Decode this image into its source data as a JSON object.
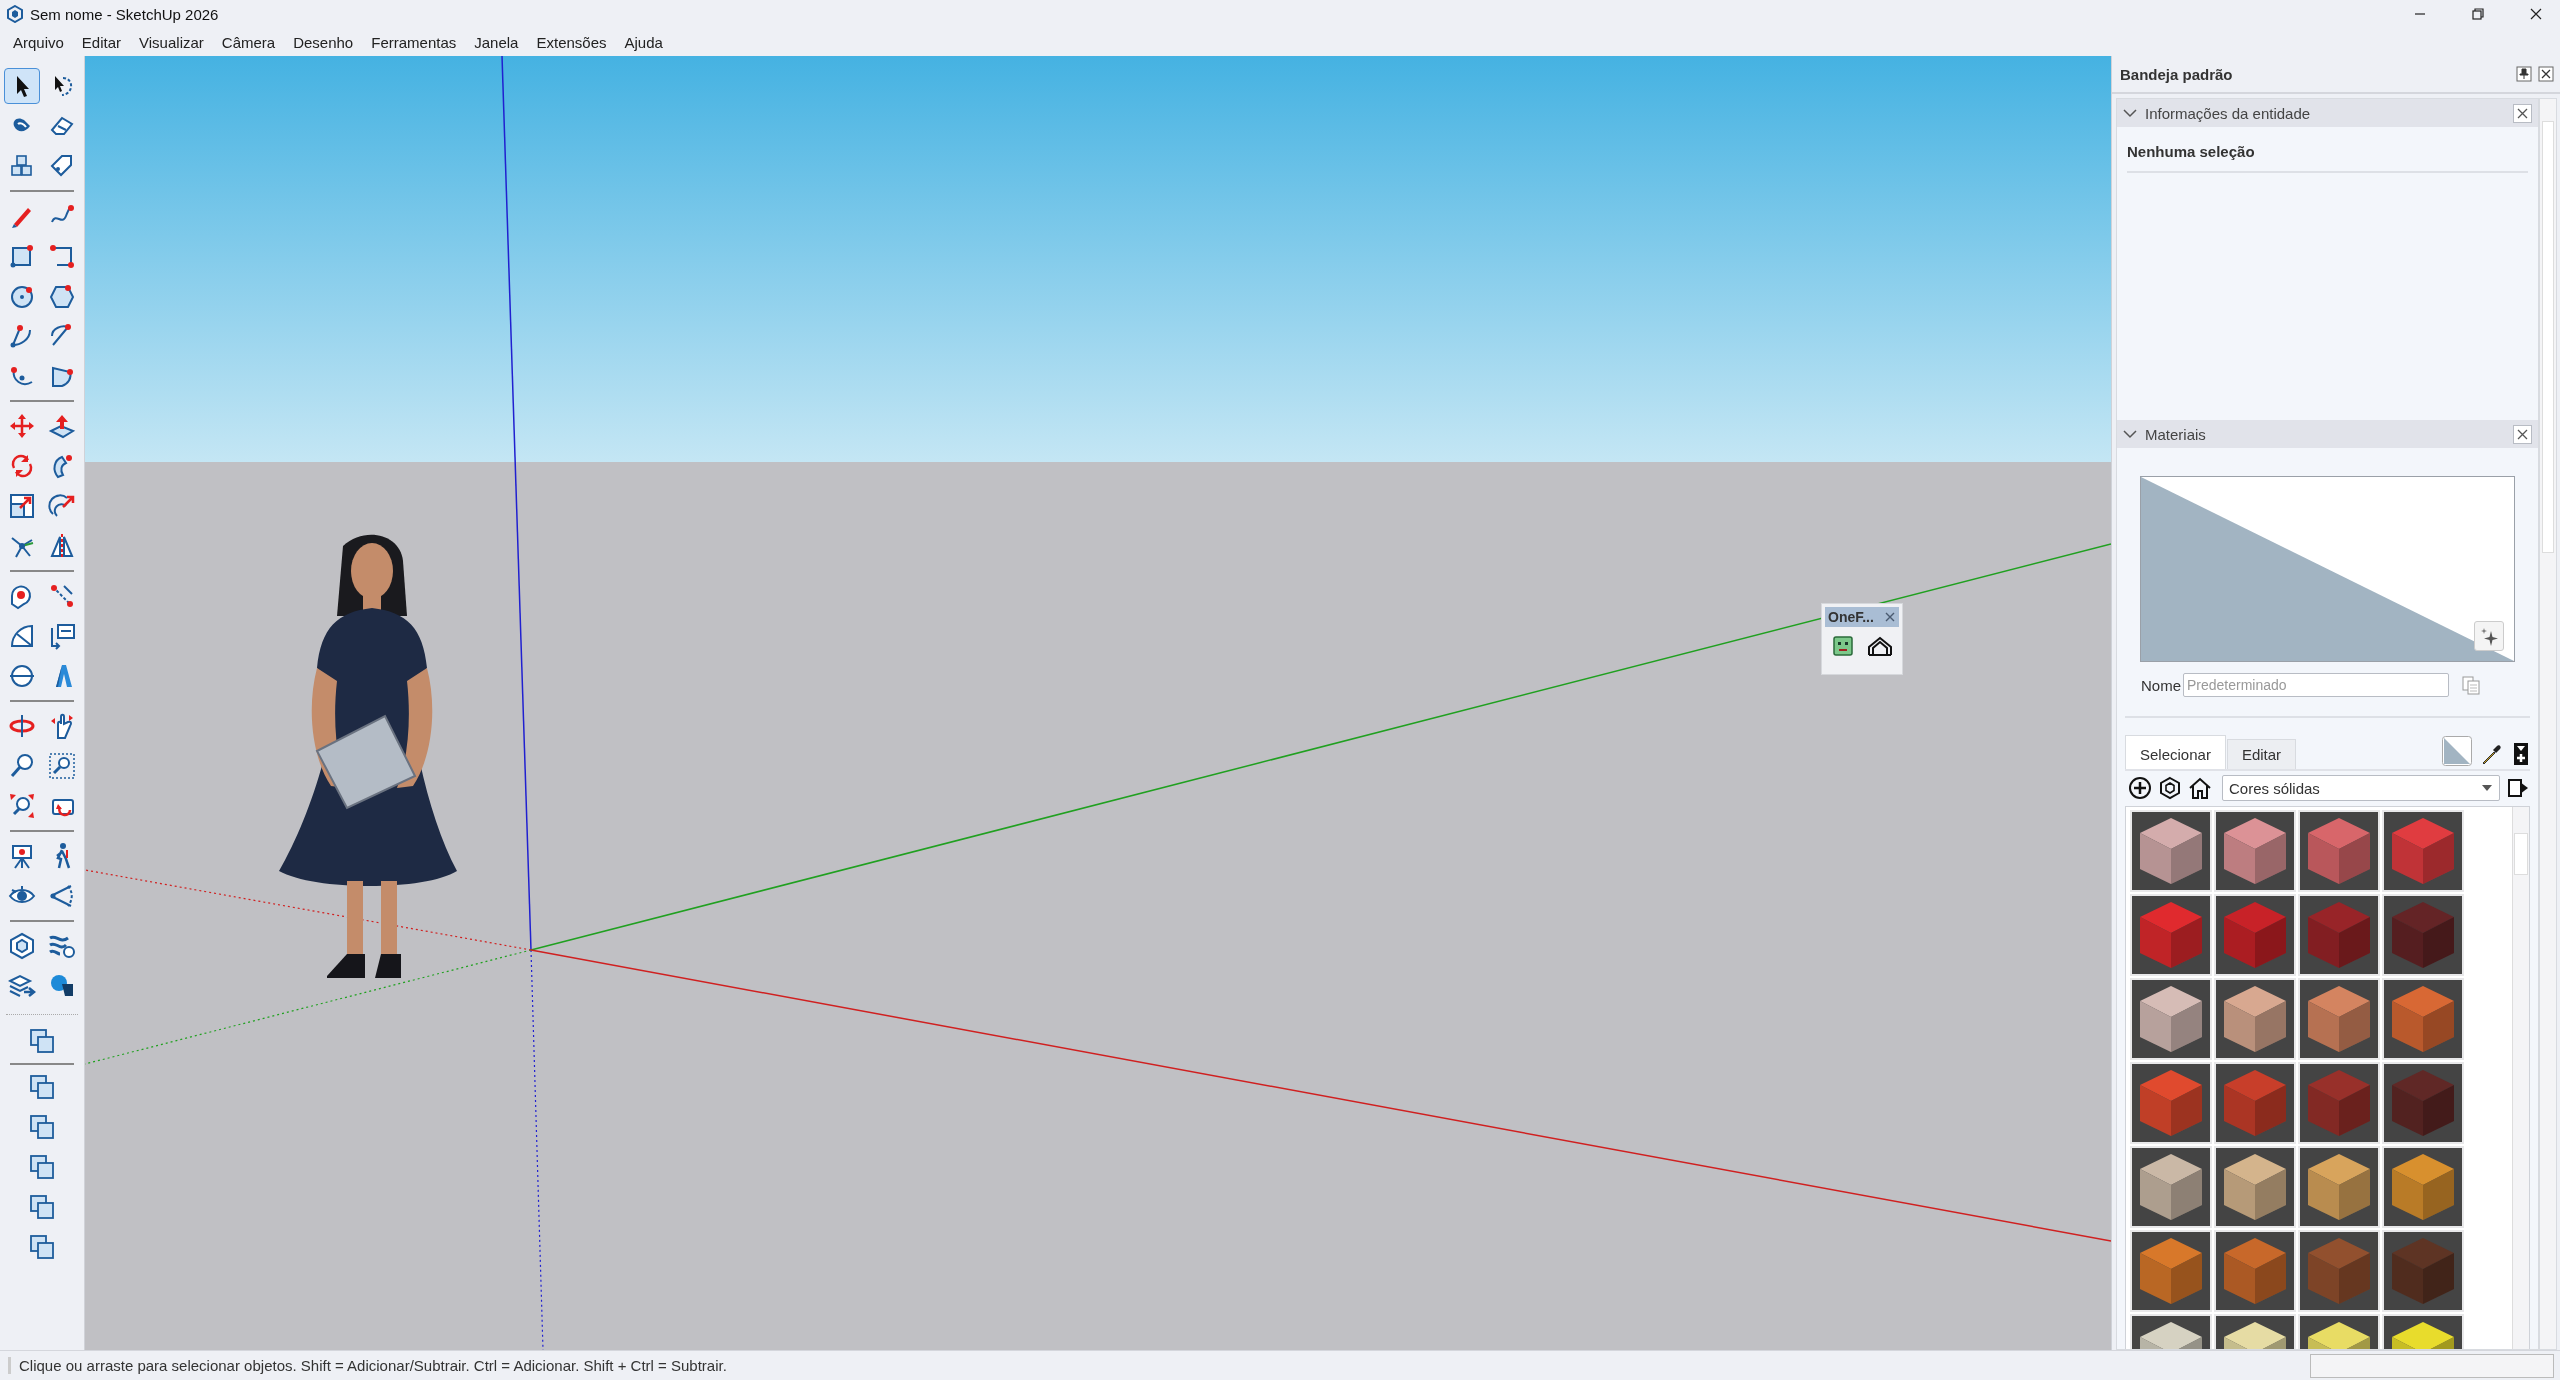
{
  "window": {
    "title": "Sem nome - SketchUp 2026"
  },
  "menu": [
    "Arquivo",
    "Editar",
    "Visualizar",
    "Câmera",
    "Desenho",
    "Ferramentas",
    "Janela",
    "Extensões",
    "Ajuda"
  ],
  "toolbar": {
    "groups": [
      {
        "tools": [
          {
            "selected": true
          },
          {
            "selected": false
          },
          {
            "selected": false
          },
          {
            "selected": false
          },
          {
            "selected": false
          },
          {
            "selected": false
          }
        ]
      },
      {
        "tools": [
          {
            "selected": false
          },
          {
            "selected": false
          },
          {
            "selected": false
          },
          {
            "selected": false
          },
          {
            "selected": false
          },
          {
            "selected": false
          },
          {
            "selected": false
          },
          {
            "selected": false
          },
          {
            "selected": false
          },
          {
            "selected": false
          }
        ]
      },
      {
        "tools": [
          {
            "selected": false
          },
          {
            "selected": false
          },
          {
            "selected": false
          },
          {
            "selected": false
          },
          {
            "selected": false
          },
          {
            "selected": false
          },
          {
            "selected": false
          },
          {
            "selected": false
          }
        ]
      },
      {
        "tools": [
          {
            "selected": false
          },
          {
            "selected": false
          },
          {
            "selected": false
          },
          {
            "selected": false
          },
          {
            "selected": false
          },
          {
            "selected": false
          }
        ]
      },
      {
        "tools": [
          {
            "selected": false
          },
          {
            "selected": false
          },
          {
            "selected": false
          },
          {
            "selected": false
          },
          {
            "selected": false
          },
          {
            "selected": false
          }
        ]
      },
      {
        "tools": [
          {
            "selected": false
          },
          {
            "selected": false
          },
          {
            "selected": false
          },
          {
            "selected": false
          }
        ]
      },
      {
        "tools": [
          {
            "selected": false
          },
          {
            "selected": false
          },
          {
            "selected": false
          },
          {
            "selected": false
          }
        ]
      }
    ]
  },
  "floating_toolbar": {
    "title": "OneF..."
  },
  "tray": {
    "title": "Bandeja padrão",
    "panels": [
      {
        "kind": "entity_info",
        "title": "Informações da entidade",
        "expanded": true,
        "heading": "Nenhuma seleção"
      },
      {
        "kind": "materials",
        "title": "Materiais",
        "expanded": true,
        "name_field": {
          "label": "Nome",
          "placeholder": "Predeterminado"
        },
        "tabs": [
          {
            "label": "Selecionar",
            "selected": true
          },
          {
            "label": "Editar",
            "selected": false
          }
        ],
        "collection": "Cores sólidas",
        "swatches": [
          {
            "color": "#d4acac"
          },
          {
            "color": "#dc9296"
          },
          {
            "color": "#d8666a"
          },
          {
            "color": "#e03c40"
          },
          {
            "color": "#e02a2e"
          },
          {
            "color": "#c82228"
          },
          {
            "color": "#982428"
          },
          {
            "color": "#642426"
          },
          {
            "color": "#d6bcb6"
          },
          {
            "color": "#d8a890"
          },
          {
            "color": "#d48460"
          },
          {
            "color": "#d86834"
          },
          {
            "color": "#e04a2e"
          },
          {
            "color": "#c83e2a"
          },
          {
            "color": "#98302a"
          },
          {
            "color": "#602826"
          },
          {
            "color": "#cab8a6"
          },
          {
            "color": "#d4b48c"
          },
          {
            "color": "#d8a45c"
          },
          {
            "color": "#d8902e"
          },
          {
            "color": "#d8782a"
          },
          {
            "color": "#c8682a"
          },
          {
            "color": "#92502e"
          },
          {
            "color": "#5e3424"
          },
          {
            "color": "#d6d2c2"
          },
          {
            "color": "#e6dca4"
          },
          {
            "color": "#e8dc64"
          },
          {
            "color": "#e8dc2c"
          }
        ]
      }
    ]
  },
  "status_bar": {
    "text": "Clique ou arraste para selecionar objetos. Shift = Adicionar/Subtrair. Ctrl = Adicionar. Shift + Ctrl = Subtrair."
  }
}
